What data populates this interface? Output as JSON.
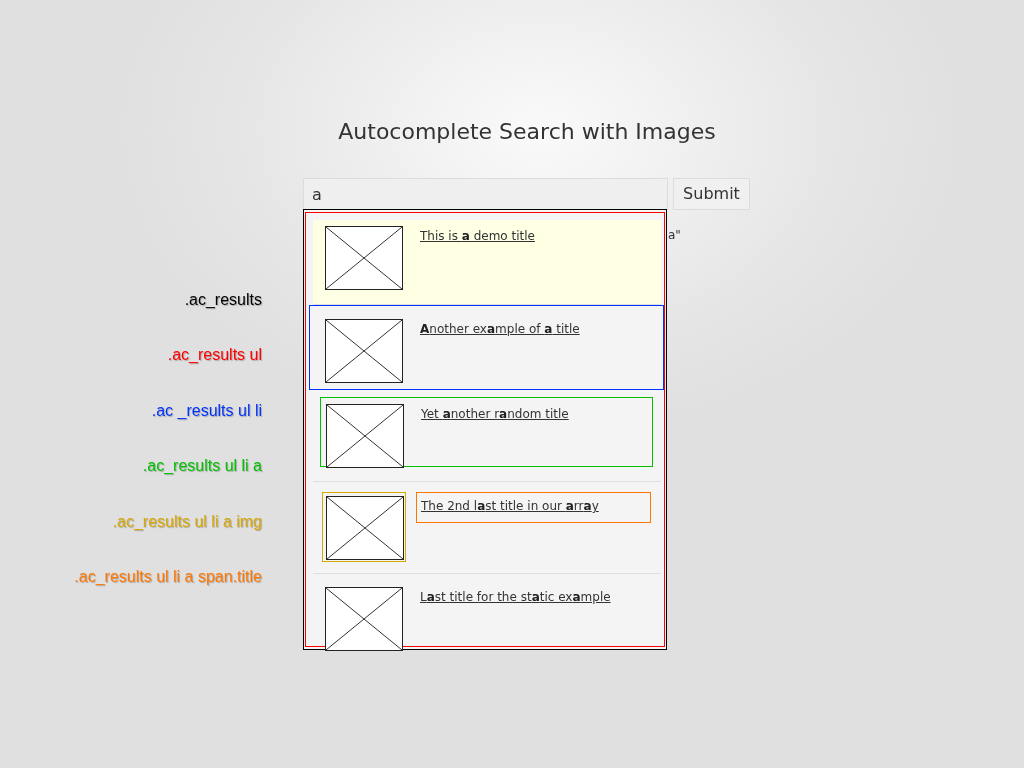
{
  "title": "Autocomplete Search with Images",
  "legend": [
    {
      "label": ".ac_results",
      "color": "#000000"
    },
    {
      "label": ".ac_results ul",
      "color": "#ff0000"
    },
    {
      "label": ".ac _results ul li",
      "color": "#0033ff"
    },
    {
      "label": ".ac_results ul li a",
      "color": "#00c000"
    },
    {
      "label": ".ac_results ul li a img",
      "color": "#d9a800"
    },
    {
      "label": ".ac_results ul li a span.title",
      "color": "#ff7700"
    }
  ],
  "search": {
    "value": "a"
  },
  "submit": {
    "label": "Submit"
  },
  "behind_text": "a\"",
  "results": [
    {
      "title": "This is **a** demo title",
      "selected": true,
      "kind": "plain"
    },
    {
      "title": "**A**nother ex**a**mple of **a** title",
      "selected": false,
      "kind": "item"
    },
    {
      "title": "Yet **a**nother r**a**ndom title",
      "selected": false,
      "kind": "link"
    },
    {
      "title": "The 2nd l**a**st title in our **a**rr**a**y",
      "selected": false,
      "kind": "parts"
    },
    {
      "title": "L**a**st title for the st**a**tic ex**a**mple",
      "selected": false,
      "kind": "plain"
    }
  ]
}
